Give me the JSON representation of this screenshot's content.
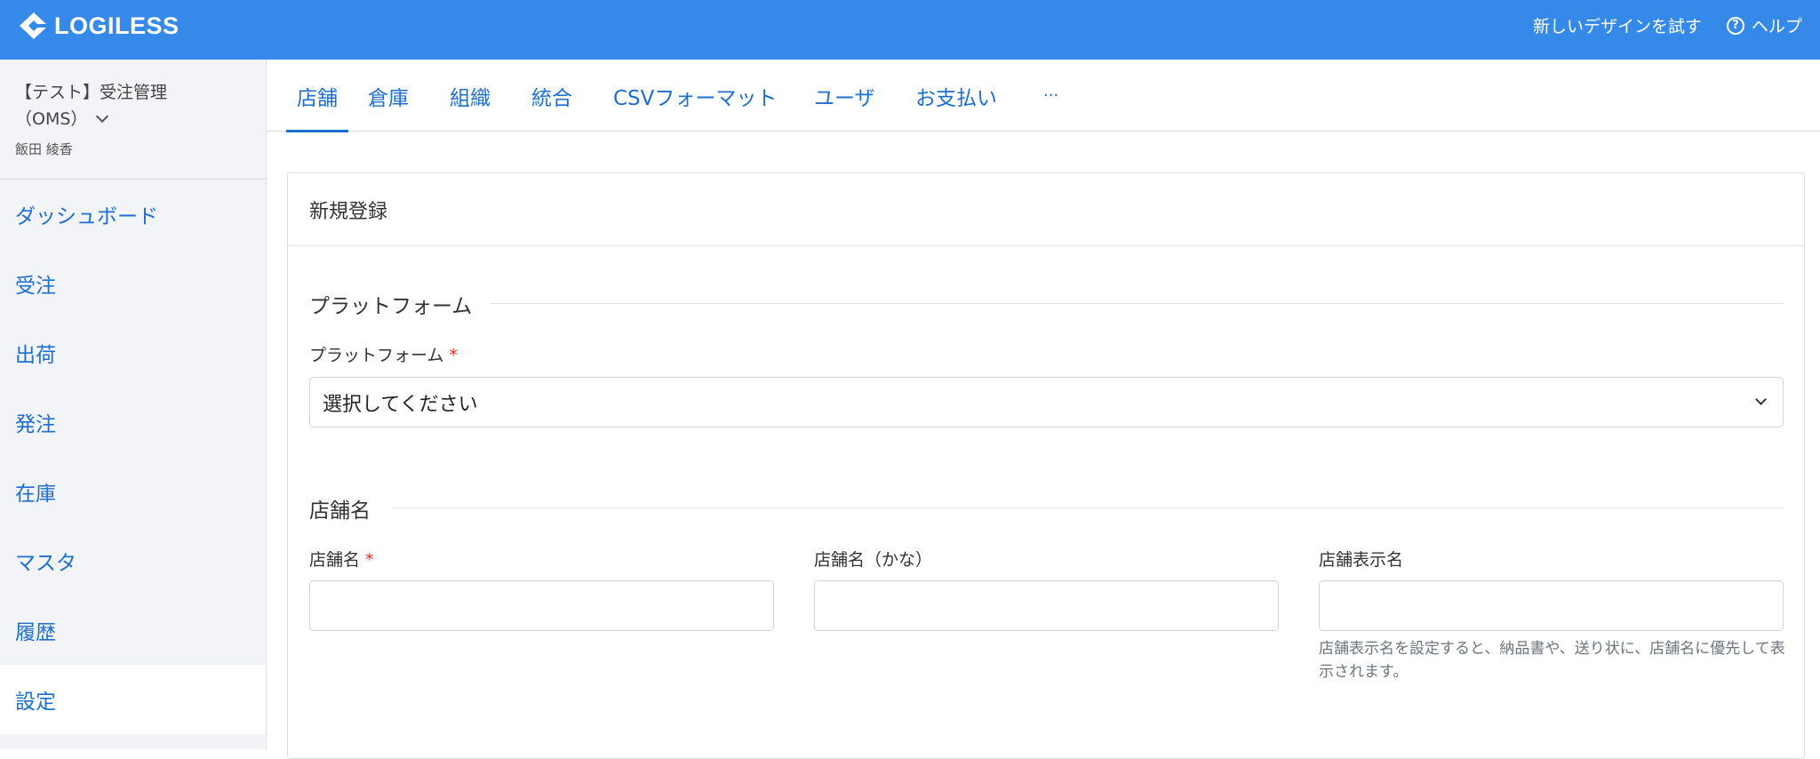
{
  "header": {
    "logo_text": "LOGILESS",
    "try_new_design": "新しいデザインを試す",
    "help_label": "ヘルプ",
    "brand_color": "#3589e8"
  },
  "sidebar": {
    "org_name_line1": "【テスト】受注管理",
    "org_name_line2": "（OMS）",
    "user_name": "飯田 綾香",
    "items": [
      {
        "label": "ダッシュボード"
      },
      {
        "label": "受注"
      },
      {
        "label": "出荷"
      },
      {
        "label": "発注"
      },
      {
        "label": "在庫"
      },
      {
        "label": "マスタ"
      },
      {
        "label": "履歴"
      },
      {
        "label": "設定",
        "active": true
      }
    ]
  },
  "tabs": [
    {
      "label": "店舗",
      "active": true
    },
    {
      "label": "倉庫"
    },
    {
      "label": "組織"
    },
    {
      "label": "統合"
    },
    {
      "label": "CSVフォーマット"
    },
    {
      "label": "ユーザ"
    },
    {
      "label": "お支払い"
    },
    {
      "label": "···"
    }
  ],
  "form": {
    "card_title": "新規登録",
    "platform_section": "プラットフォーム",
    "platform_label": "プラットフォーム",
    "platform_placeholder": "選択してください",
    "required_mark": "*",
    "store_section": "店舗名",
    "store_name_label": "店舗名",
    "store_kana_label": "店舗名（かな）",
    "store_display_label": "店舗表示名",
    "store_display_hint": "店舗表示名を設定すると、納品書や、送り状に、店舗名に優先して表示されます。"
  }
}
